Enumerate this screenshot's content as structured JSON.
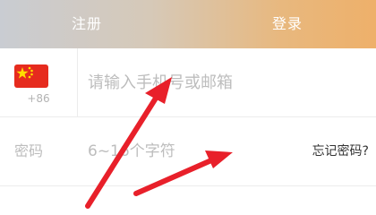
{
  "tabs": {
    "register": "注册",
    "login": "登录"
  },
  "phone": {
    "country_code": "+86",
    "placeholder": "请输入手机号或邮箱"
  },
  "password": {
    "label": "密码",
    "placeholder": "6~16个字符",
    "forgot": "忘记密码?"
  },
  "colors": {
    "tab_gradient_start": "#c9ccd2",
    "tab_gradient_end": "#eeb06a",
    "annotation_arrow": "#e8202a",
    "flag_red": "#e62b1e",
    "flag_star": "#ffde00"
  }
}
